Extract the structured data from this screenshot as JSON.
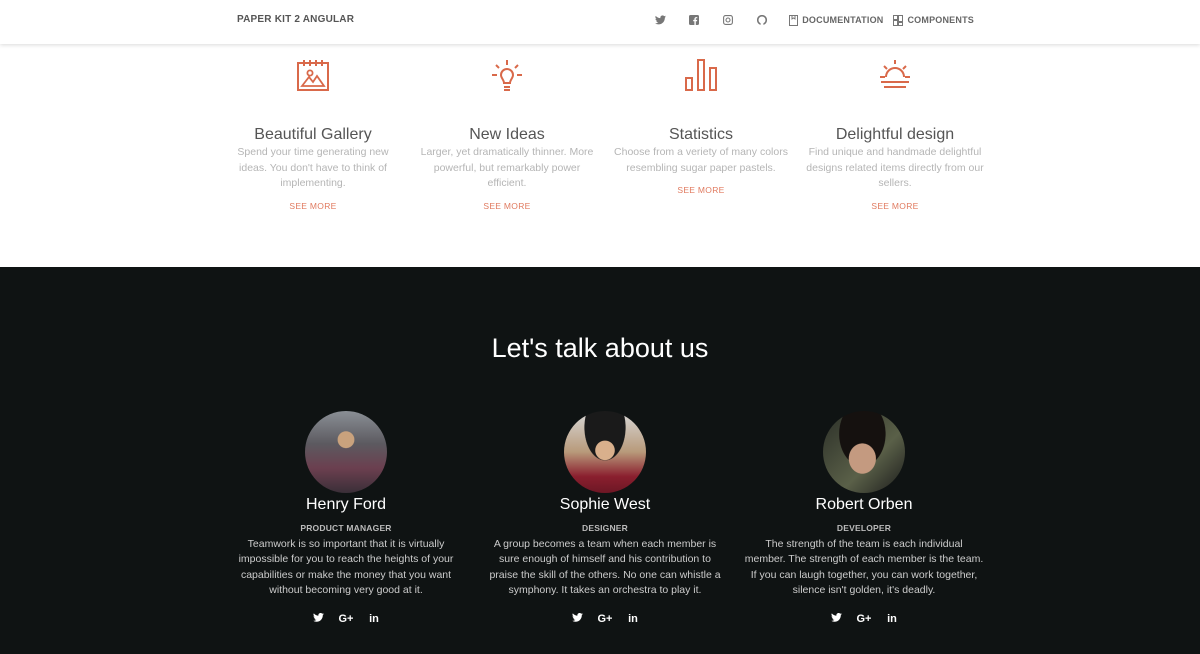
{
  "navbar": {
    "brand": "PAPER KIT 2 ANGULAR",
    "icons": [
      "twitter-icon",
      "facebook-icon",
      "instagram-icon",
      "github-icon"
    ],
    "links": [
      {
        "label": "DOCUMENTATION",
        "icon": "book-icon"
      },
      {
        "label": "COMPONENTS",
        "icon": "grid-icon"
      }
    ]
  },
  "features": [
    {
      "icon": "gallery-icon",
      "title": "Beautiful Gallery",
      "text": "Spend your time generating new ideas. You don't have to think of implementing.",
      "link": "SEE MORE"
    },
    {
      "icon": "bulb-icon",
      "title": "New Ideas",
      "text": "Larger, yet dramatically thinner. More powerful, but remarkably power efficient.",
      "link": "SEE MORE"
    },
    {
      "icon": "chart-bar-icon",
      "title": "Statistics",
      "text": "Choose from a veriety of many colors resembling sugar paper pastels.",
      "link": "SEE MORE"
    },
    {
      "icon": "sunrise-icon",
      "title": "Delightful design",
      "text": "Find unique and handmade delightful designs related items directly from our sellers.",
      "link": "SEE MORE"
    }
  ],
  "team": {
    "title": "Let's talk about us",
    "members": [
      {
        "name": "Henry Ford",
        "role": "PRODUCT MANAGER",
        "bio": "Teamwork is so important that it is virtually impossible for you to reach the heights of your capabilities or make the money that you want without becoming very good at it."
      },
      {
        "name": "Sophie West",
        "role": "DESIGNER",
        "bio": "A group becomes a team when each member is sure enough of himself and his contribution to praise the skill of the others. No one can whistle a symphony. It takes an orchestra to play it."
      },
      {
        "name": "Robert Orben",
        "role": "DEVELOPER",
        "bio": "The strength of the team is each individual member. The strength of each member is the team. If you can laugh together, you can work together, silence isn't golden, it's deadly."
      }
    ],
    "social_labels": {
      "google": "G+",
      "linkedin": "in"
    }
  },
  "colors": {
    "accent": "#e07a5f",
    "dark_bg": "#0f1313"
  }
}
